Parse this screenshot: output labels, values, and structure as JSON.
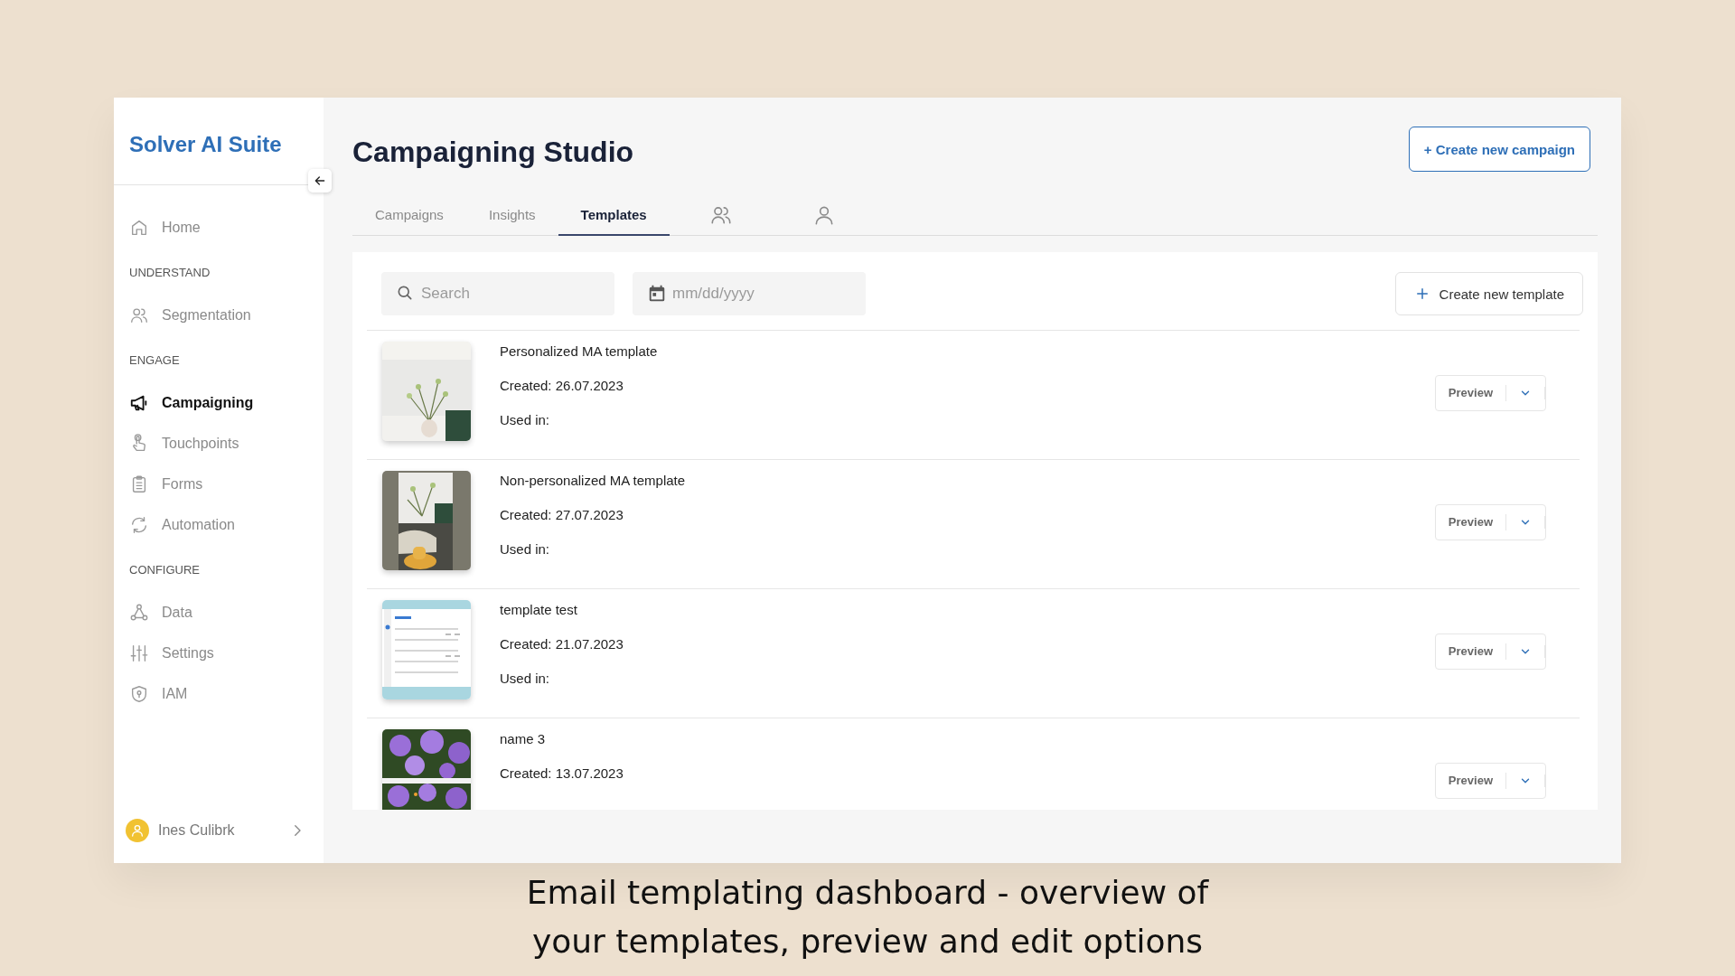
{
  "sidebar": {
    "logo": "Solver AI Suite",
    "items": [
      {
        "kind": "link",
        "label": "Home",
        "selected": false
      },
      {
        "kind": "section",
        "label": "UNDERSTAND"
      },
      {
        "kind": "link",
        "label": "Segmentation",
        "selected": false
      },
      {
        "kind": "section",
        "label": "ENGAGE"
      },
      {
        "kind": "link",
        "label": "Campaigning",
        "selected": true
      },
      {
        "kind": "link",
        "label": "Touchpoints",
        "selected": false
      },
      {
        "kind": "link",
        "label": "Forms",
        "selected": false
      },
      {
        "kind": "link",
        "label": "Automation",
        "selected": false
      },
      {
        "kind": "section",
        "label": "CONFIGURE"
      },
      {
        "kind": "link",
        "label": "Data",
        "selected": false
      },
      {
        "kind": "link",
        "label": "Settings",
        "selected": false
      },
      {
        "kind": "link",
        "label": "IAM",
        "selected": false
      }
    ],
    "user": {
      "name": "Ines Culibrk"
    }
  },
  "main": {
    "title": "Campaigning Studio",
    "create_button": "+ Create new campaign",
    "tabs": [
      {
        "kind": "text",
        "label": "Campaigns",
        "selected": false
      },
      {
        "kind": "text",
        "label": "Insights",
        "selected": false
      },
      {
        "kind": "text",
        "label": "Templates",
        "selected": true
      },
      {
        "kind": "icon",
        "selected": false
      },
      {
        "kind": "icon",
        "selected": false
      }
    ],
    "search": {
      "placeholder": "Search"
    },
    "date": {
      "placeholder": "mm/dd/yyyy"
    },
    "create_template_button": "Create new template",
    "templates": [
      {
        "name": "Personalized MA template",
        "created": "Created: 26.07.2023",
        "used_in": "Used in:",
        "preview_button": "Preview"
      },
      {
        "name": "Non-personalized MA template",
        "created": "Created: 27.07.2023",
        "used_in": "Used in:",
        "preview_button": "Preview"
      },
      {
        "name": "template test",
        "created": "Created: 21.07.2023",
        "used_in": "Used in:",
        "preview_button": "Preview"
      },
      {
        "name": "name 3",
        "created": "Created: 13.07.2023",
        "preview_button": "Preview"
      }
    ]
  },
  "caption": "Email templating dashboard - overview of your templates, preview and edit options"
}
